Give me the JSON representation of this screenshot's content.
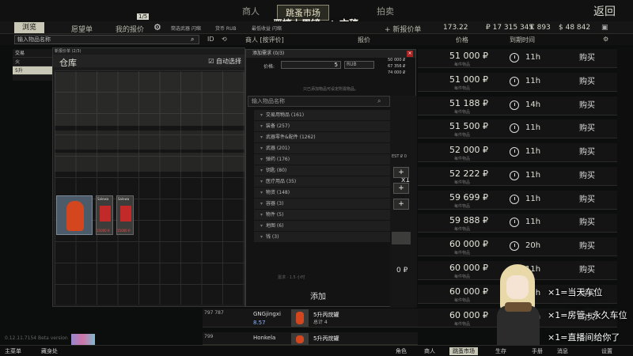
{
  "topbar": {
    "tabs": [
      {
        "label": "商人"
      },
      {
        "label": "跳蚤市场"
      },
      {
        "label": "拍卖"
      }
    ],
    "back_label": "返回",
    "stream_title": "恶搞上周镜一：文稿"
  },
  "subbar": {
    "tabs": [
      "浏览",
      "愿望单",
      "我的报价"
    ],
    "offer_count": "1/5",
    "filters": [
      "筒选武器 闪缩",
      "货币 RUB",
      "最低收益 闪缩"
    ],
    "add_offer": "+ 新报价单",
    "balances": [
      "173.22",
      "₽ 17 315 345",
      "€ 893",
      "$ 48 842"
    ]
  },
  "search": {
    "placeholder": "输入物品名称",
    "id_label": "ID",
    "col_trader": "商人 [按评价]",
    "col_price_left": "报价",
    "col_price": "价格",
    "col_expiry": "到期时间"
  },
  "sidebar": {
    "items": [
      "交易",
      "火",
      "5升"
    ]
  },
  "stash": {
    "mini_label": "新报价单 (2/3)",
    "title": "仓库",
    "auto_select": "自动选择",
    "packs": [
      {
        "name": "Salewa",
        "price": "15000 ₽"
      },
      {
        "name": "Salewa",
        "price": "15000 ₽"
      }
    ]
  },
  "dialog": {
    "title": "添加需求 (0/3)",
    "qty_label": "价格:",
    "qty_value": "5",
    "qty_unit": "RUB",
    "hint": "只已添加物品可设定所需物品。",
    "search_placeholder": "输入物品名称",
    "categories": [
      "交易用物品 (161)",
      "装备 (257)",
      "武器零件&配件 (1262)",
      "武器 (201)",
      "弹药 (176)",
      "钥匙 (80)",
      "医疗用品 (35)",
      "物资 (148)",
      "容器 (3)",
      "物件 (5)",
      "地图 (6)",
      "钱 (3)"
    ],
    "multiplier": "x1",
    "est_label": "EST ₽ 0",
    "plus": [
      "+",
      "+",
      "+"
    ],
    "total": "0 ₽",
    "footer": "需求 · 1.5 小时",
    "add_button": "添加",
    "req_values": [
      "50 000 ₽",
      "67 356 ₽",
      "74 000 ₽"
    ]
  },
  "offers": [
    {
      "price": "51 000 ₽",
      "sub": "每件物品",
      "time": "11h",
      "buy": "购买"
    },
    {
      "price": "51 000 ₽",
      "sub": "每件物品",
      "time": "11h",
      "buy": "购买"
    },
    {
      "price": "51 188 ₽",
      "sub": "每件物品",
      "time": "14h",
      "buy": "购买"
    },
    {
      "price": "51 500 ₽",
      "sub": "每件物品",
      "time": "11h",
      "buy": "购买"
    },
    {
      "price": "52 000 ₽",
      "sub": "每件物品",
      "time": "11h",
      "buy": "购买"
    },
    {
      "price": "52 222 ₽",
      "sub": "每件物品",
      "time": "11h",
      "buy": "购买"
    },
    {
      "price": "59 699 ₽",
      "sub": "每件物品",
      "time": "11h",
      "buy": "购买"
    },
    {
      "price": "59 888 ₽",
      "sub": "每件物品",
      "time": "11h",
      "buy": "购买"
    },
    {
      "price": "60 000 ₽",
      "sub": "每件物品",
      "time": "20h",
      "buy": "购买"
    },
    {
      "price": "60 000 ₽",
      "sub": "每件物品",
      "time": "11h",
      "buy": "购买"
    },
    {
      "price": "60 000 ₽",
      "sub": "每件物品",
      "time": "11h",
      "buy": "购买"
    },
    {
      "price": "60 000 ₽",
      "sub": "每件物品",
      "time": "20h",
      "buy": "购买"
    }
  ],
  "sellers": [
    {
      "lvl": "797\n787",
      "name": "GNGjingxi",
      "rating": "8.57",
      "item": "5升丙烷罐",
      "total": "总计 4"
    },
    {
      "lvl": "799",
      "name": "Honkela",
      "rating": "",
      "item": "5升丙烷罐",
      "total": ""
    }
  ],
  "overlay": {
    "lines": [
      "×1=当天车位",
      "×1=房管+永久车位",
      "×1=直播间给你了"
    ]
  },
  "taskbar": {
    "left": [
      "主菜单",
      "藏身处"
    ],
    "right": [
      "角色",
      "商人",
      "跳蚤市场",
      "生存",
      "手册",
      "消息",
      "设置"
    ]
  },
  "version": "0.12.11.7154 Beta version"
}
